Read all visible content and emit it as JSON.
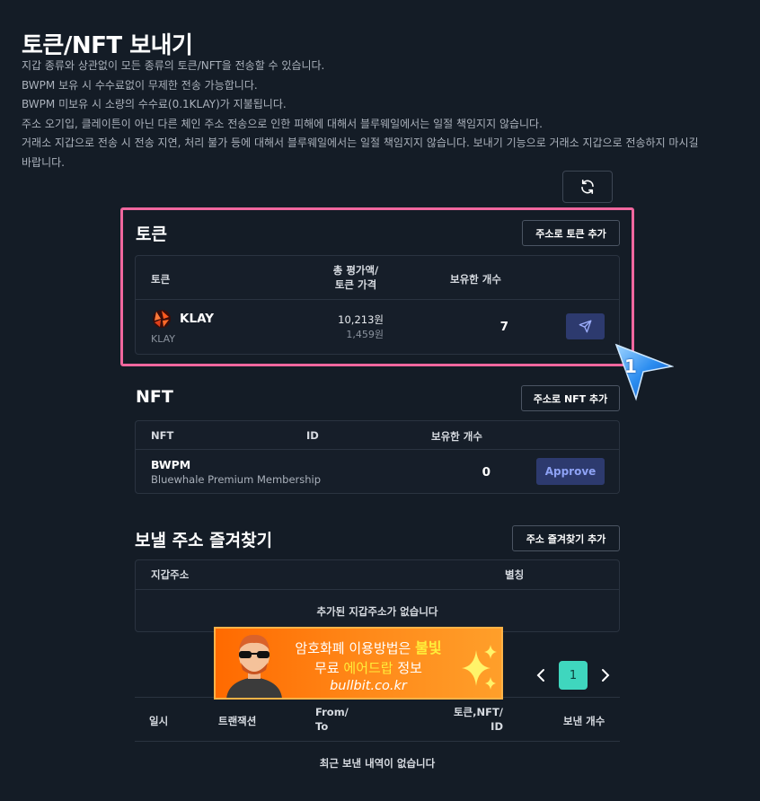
{
  "page": {
    "title": "토큰/NFT 보내기",
    "notices": [
      "지갑 종류와 상관없이 모든 종류의 토큰/NFT을 전송할 수 있습니다.",
      "BWPM 보유 시 수수료없이 무제한 전송 가능합니다.",
      "BWPM 미보유 시 소량의 수수료(0.1KLAY)가 지불됩니다.",
      "주소 오기입, 클레이튼이 아닌 다른 체인 주소 전송으로 인한 피해에 대해서 블루웨일에서는 일절 책임지지 않습니다.",
      "거래소 지갑으로 전송 시 전송 지연, 처리 불가 등에 대해서 블루웨일에서는 일절 책임지지 않습니다. 보내기 기능으로 거래소 지갑으로 전송하지 마시길",
      "바랍니다."
    ]
  },
  "token_section": {
    "title": "토큰",
    "add_button": "주소로 토큰 추가",
    "columns": {
      "token": "토큰",
      "value_line1": "총 평가액/",
      "value_line2": "토큰 가격",
      "count": "보유한 개수"
    },
    "rows": [
      {
        "symbol": "KLAY",
        "sub": "KLAY",
        "total_value": "10,213원",
        "price": "1,459원",
        "count": "7"
      }
    ]
  },
  "nft_section": {
    "title": "NFT",
    "add_button": "주소로 NFT 추가",
    "columns": {
      "nft": "NFT",
      "id": "ID",
      "count": "보유한 개수"
    },
    "rows": [
      {
        "name": "BWPM",
        "full_name": "Bluewhale Premium Membership",
        "count": "0",
        "action": "Approve"
      }
    ]
  },
  "favorites_section": {
    "title": "보낼 주소 즐겨찾기",
    "add_button": "주소 즐겨찾기 추가",
    "columns": {
      "address": "지갑주소",
      "alias": "별칭"
    },
    "empty_text": "추가된 지갑주소가 없습니다"
  },
  "pagination": {
    "current": "1",
    "prev_icon": "chevron-left-icon",
    "next_icon": "chevron-right-icon"
  },
  "history_section": {
    "columns": {
      "date": "일시",
      "tx": "트랜잭션",
      "from_line1": "From/",
      "from_line2": "To",
      "token_line1": "토큰,NFT/",
      "token_line2": "ID",
      "count": "보낸 개수"
    },
    "empty_text": "최근 보낸 내역이 없습니다"
  },
  "banner": {
    "line1_white": "암호화폐 이용방법은 ",
    "line1_yellow": "불빛",
    "line2_white1": "무료 ",
    "line2_yellow": "에어드랍",
    "line2_white2": " 정보",
    "url": "bullbit.co.kr"
  },
  "annotation": {
    "number": "1"
  },
  "colors": {
    "background": "#141c26",
    "highlight": "#f0679e",
    "accent_teal": "#3fd6be",
    "button_blue": "#2d3a6e",
    "banner_orange": "#ff7a10"
  }
}
